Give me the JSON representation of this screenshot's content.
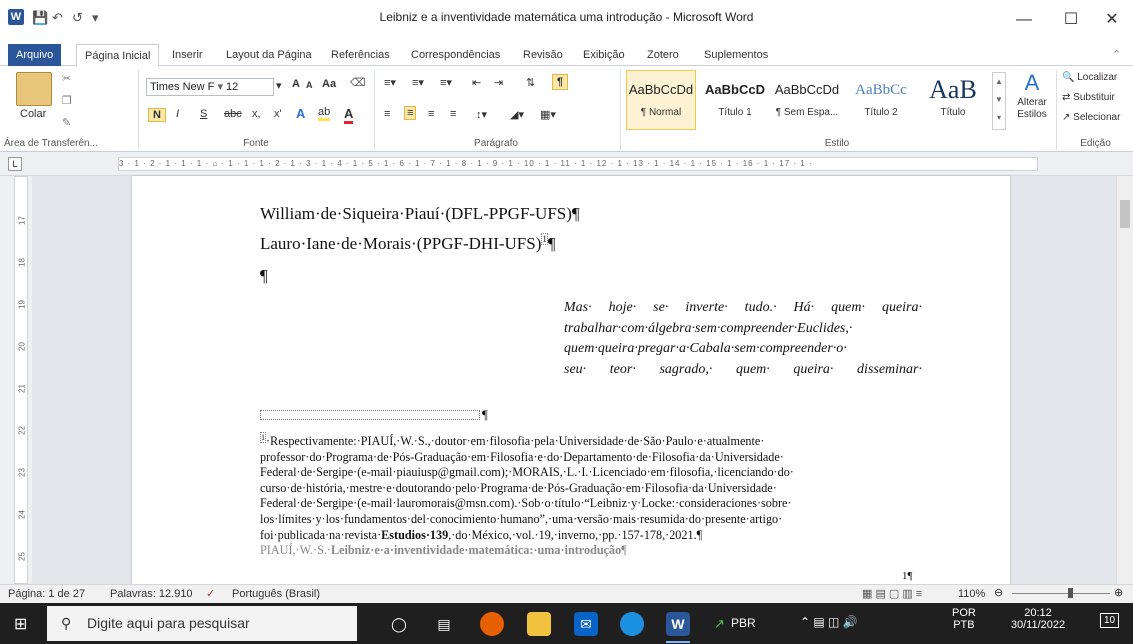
{
  "titlebar": {
    "title": "Leibniz e a inventividade matemática uma introdução - Microsoft Word",
    "app_icon": "W",
    "qat": [
      "save-icon",
      "undo-icon",
      "redo-icon",
      "customize-icon"
    ],
    "min": "—",
    "max": "☐",
    "close": "✕"
  },
  "tabs": [
    "Arquivo",
    "Página Inicial",
    "Inserir",
    "Layout da Página",
    "Referências",
    "Correspondências",
    "Revisão",
    "Exibição",
    "Zotero",
    "Suplementos"
  ],
  "ribbon": {
    "clipboard": {
      "paste": "Colar",
      "label": "Área de Transferên..."
    },
    "font": {
      "family": "Times New F",
      "size": "12",
      "label": "Fonte",
      "bold": "N",
      "italic": "I",
      "underline": "S",
      "strike": "abc",
      "sub": "x,",
      "sup": "x'",
      "aa": "Aa",
      "grow": "A",
      "shrink": "A"
    },
    "paragraph": {
      "label": "Parágrafo",
      "pilcrow": "¶"
    },
    "styles": {
      "label": "Estilo",
      "items": [
        {
          "sample": "AaBbCcDd",
          "name": "¶ Normal"
        },
        {
          "sample": "AaBbCcD",
          "name": "Título 1"
        },
        {
          "sample": "AaBbCcDd",
          "name": "¶ Sem Espa..."
        },
        {
          "sample": "AaBbCc",
          "name": "Título 2"
        },
        {
          "sample": "AaB",
          "name": "Título"
        }
      ],
      "change": "Alterar Estilos"
    },
    "editing": {
      "label": "Edição",
      "find": "Localizar",
      "replace": "Substituir",
      "select": "Selecionar"
    }
  },
  "ruler": {
    "marks": "3 · 1 · 2 · 1 · 1 · 1 · ⌂ · 1 · 1 · 1 · 2 · 1 · 3 · 1 · 4 · 1 · 5 · 1 · 6 · 1 · 7 · 1 · 8 · 1 · 9 · 1 · 10 · 1 · 11 · 1 · 12 · 1 · 13 · 1 · 14 · 1 · 15 · 1 · 16 · 1 · 17 · 1 ·",
    "vticks": [
      "17",
      "18",
      "19",
      "20",
      "21",
      "22",
      "23",
      "24",
      "25"
    ]
  },
  "doc": {
    "author1": "William·de·Siqueira·Piauí·(DFL-PPGF-UFS)¶",
    "author2": "Lauro·Iane·de·Morais·(PPGF-DHI-UFS)",
    "footnote_ref": "1",
    "pilcrow": "¶",
    "quote": [
      "Mas· hoje· se· inverte· tudo.· Há· quem· queira·",
      "trabalhar·com·álgebra·sem·compreender·Euclides,·",
      "quem·queira·pregar·a·Cabala·sem·compreender·o·",
      "seu· teor· sagrado,· quem· queira· disseminar·"
    ],
    "fn_sep_mark": "¶",
    "footnote": [
      "·Respectivamente:·PIAUÍ,·W.·S.,·doutor·em·filosofia·pela·Universidade·de·São·Paulo·e·atualmente·",
      "professor·do·Programa·de·Pós-Graduação·em·Filosofia·e·do·Departamento·de·Filosofia·da·Universidade·",
      "Federal·de·Sergipe·(e-mail·piauiusp@gmail.com);·MORAIS,·L.·I.·Licenciado·em·filosofia,·licenciando·do·",
      "curso·de·história,·mestre·e·doutorando·pelo·Programa·de·Pós-Graduação·em·Filosofia·da·Universidade·",
      "Federal·de·Sergipe·(e-mail·lauromorais@msn.com).·Sob·o·título·“Leibniz·y·Locke:·consideraciones·sobre·",
      "los·límites·y·los·fundamentos·del·conocimiento·humano”,·uma·versão·mais·resumida·do·presente·artigo·"
    ],
    "fn_last_pre": "foi·publicada·na·revista·",
    "fn_last_bold": "Estudios·139",
    "fn_last_post": ",·do·México,·vol.·19,·inverno,·pp.·157-178,·2021.¶",
    "footer_pre": "PIAUÍ,·W.·S.·",
    "footer_bold": "Leibniz·e·a·inventividade·matemática:·uma·introdução",
    "footer_end": "¶",
    "page_num": "1¶"
  },
  "status": {
    "page": "Página: 1 de 27",
    "words": "Palavras: 12.910",
    "lang": "Português (Brasil)",
    "zoom": "110%"
  },
  "taskbar": {
    "search": "Digite aqui para pesquisar",
    "stock": "PBR",
    "lang1": "POR",
    "lang2": "PTB",
    "time": "20:12",
    "date": "30/11/2022",
    "notif": "10"
  }
}
